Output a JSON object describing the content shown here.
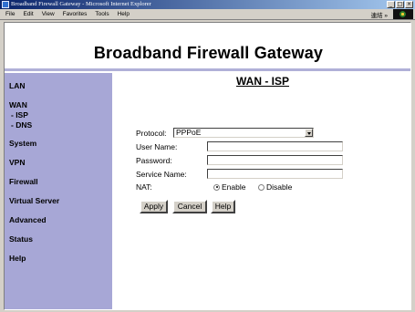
{
  "window": {
    "title": "Broadband Firewall Gateway - Microsoft Internet Explorer",
    "buttons": {
      "minimize": "_",
      "maximize": "□",
      "close": "×"
    }
  },
  "menubar": {
    "items": [
      "File",
      "Edit",
      "View",
      "Favorites",
      "Tools",
      "Help"
    ],
    "links_label": "連結 »"
  },
  "page": {
    "header_title": "Broadband Firewall Gateway",
    "section_title": "WAN - ISP"
  },
  "sidebar": {
    "items": [
      {
        "label": "LAN"
      },
      {
        "label": "WAN"
      },
      {
        "label": "- ISP"
      },
      {
        "label": "- DNS"
      },
      {
        "label": "System"
      },
      {
        "label": "VPN"
      },
      {
        "label": "Firewall"
      },
      {
        "label": "Virtual Server"
      },
      {
        "label": "Advanced"
      },
      {
        "label": "Status"
      },
      {
        "label": "Help"
      }
    ]
  },
  "form": {
    "protocol_label": "Protocol:",
    "protocol_value": "PPPoE",
    "username_label": "User Name:",
    "username_value": "",
    "password_label": "Password:",
    "password_value": "",
    "service_label": "Service Name:",
    "service_value": "",
    "nat_label": "NAT:",
    "nat_enable": "Enable",
    "nat_disable": "Disable",
    "nat_selected": "Enable"
  },
  "actions": {
    "apply": "Apply",
    "cancel": "Cancel",
    "help": "Help"
  }
}
